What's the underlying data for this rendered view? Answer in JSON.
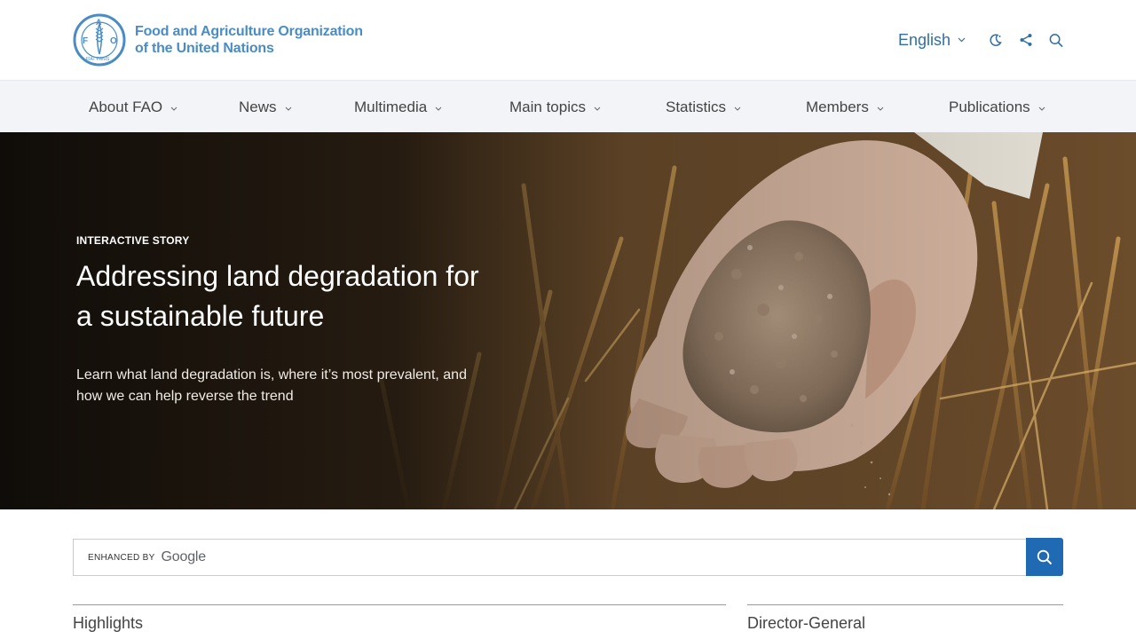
{
  "org": {
    "name_line1": "Food and Agriculture Organization",
    "name_line2": "of the United Nations",
    "emblem_text": "FAO",
    "emblem_motto": "FIAT PANIS"
  },
  "header": {
    "language": "English",
    "icons": [
      "dark-mode-icon",
      "share-icon",
      "search-icon"
    ]
  },
  "nav": {
    "items": [
      {
        "label": "About FAO"
      },
      {
        "label": "News"
      },
      {
        "label": "Multimedia"
      },
      {
        "label": "Main topics"
      },
      {
        "label": "Statistics"
      },
      {
        "label": "Members"
      },
      {
        "label": "Publications"
      }
    ]
  },
  "hero": {
    "kicker": "INTERACTIVE STORY",
    "title": "Addressing land degradation for a sustainable future",
    "subtitle": "Learn what land degradation is, where it’s most prevalent, and how we can help reverse the trend"
  },
  "search": {
    "enhanced_label": "ENHANCED BY",
    "provider": "Google"
  },
  "sections": {
    "highlights": "Highlights",
    "director_general": "Director-General"
  },
  "colors": {
    "brand_blue": "#4a8cc3",
    "link_blue": "#2f6fa6",
    "button_blue": "#1f6ab3",
    "nav_bg": "#f2f4f7"
  }
}
